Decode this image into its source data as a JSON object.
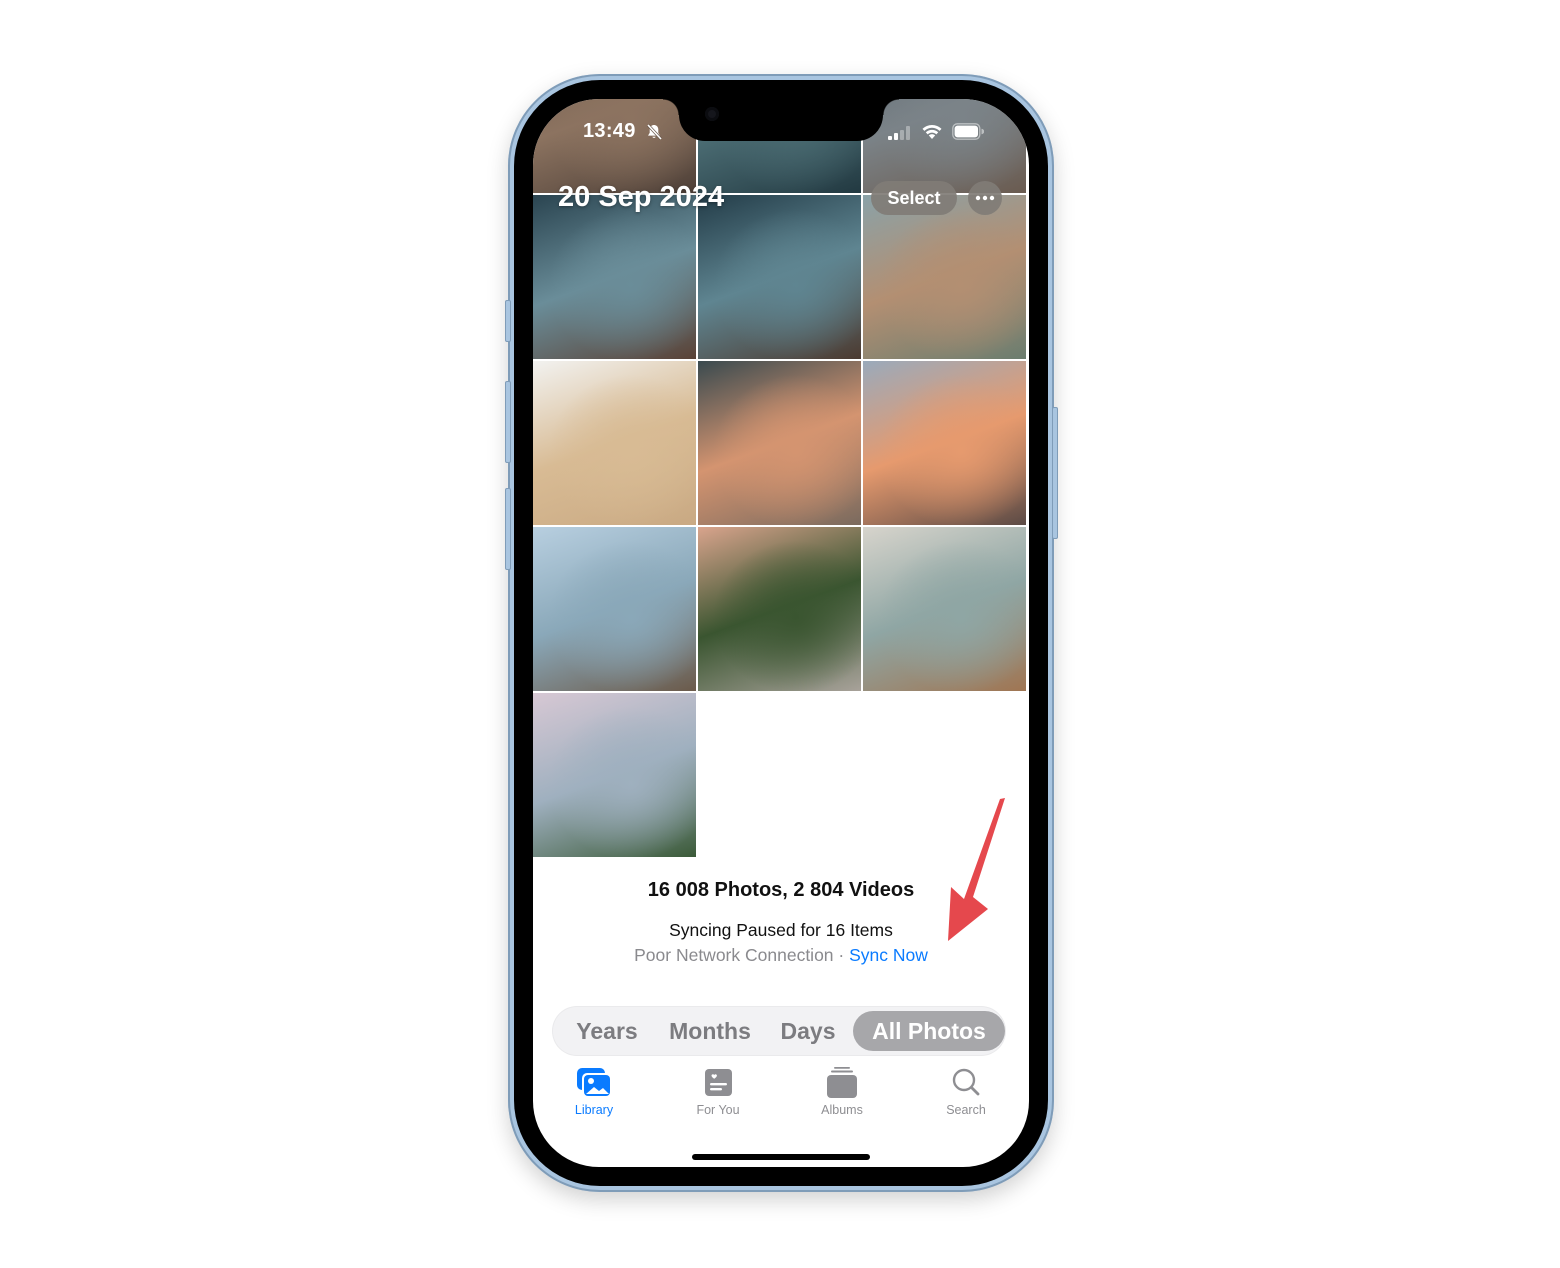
{
  "status_bar": {
    "time": "13:49",
    "silent_mode": true,
    "cellular_bars": 2,
    "wifi": true,
    "battery_level": 1.0
  },
  "header": {
    "date_title": "20 Sep 2024",
    "select_label": "Select",
    "more_icon": "ellipsis-icon"
  },
  "photos": [
    {
      "name": "beach-shore-dusk",
      "colors": [
        "#6e5a4e",
        "#8c7360",
        "#4d3f37"
      ]
    },
    {
      "name": "water-caustics",
      "colors": [
        "#2f4a55",
        "#4b6c73",
        "#223941"
      ]
    },
    {
      "name": "waves-on-sand",
      "colors": [
        "#5a6670",
        "#7b8388",
        "#6a5b50"
      ]
    },
    {
      "name": "rocky-coast-waves-1",
      "colors": [
        "#2a4450",
        "#6a8d99",
        "#5a4236"
      ]
    },
    {
      "name": "rocky-coast-waves-2",
      "colors": [
        "#233c48",
        "#5f8591",
        "#4c3a30"
      ]
    },
    {
      "name": "rose-wine-by-sea",
      "colors": [
        "#8aa2a8",
        "#b38f72",
        "#6b7d6f"
      ]
    },
    {
      "name": "starfish-on-sand",
      "colors": [
        "#f2f2f0",
        "#d8bb94",
        "#c9a983"
      ]
    },
    {
      "name": "sunset-beach-waves",
      "colors": [
        "#3a4a4f",
        "#d49470",
        "#7a6a5e"
      ]
    },
    {
      "name": "ocean-sunset",
      "colors": [
        "#9aaabb",
        "#e69a6e",
        "#5b4a45"
      ]
    },
    {
      "name": "cliff-coastline",
      "colors": [
        "#b8cfe0",
        "#8aa8b9",
        "#6b5a4a"
      ]
    },
    {
      "name": "palm-beach-pink-sky",
      "colors": [
        "#d9a48d",
        "#3a5530",
        "#a8a29a"
      ]
    },
    {
      "name": "hand-in-waves",
      "colors": [
        "#d7d4cc",
        "#8fa6a4",
        "#a07552"
      ]
    },
    {
      "name": "capri-faraglioni",
      "colors": [
        "#d7c8d4",
        "#9fb0bf",
        "#3b5a38"
      ]
    }
  ],
  "library_summary": {
    "count_text": "16 008 Photos, 2 804 Videos",
    "sync_status": "Syncing Paused for 16 Items",
    "sync_reason": "Poor Network Connection · ",
    "sync_action": "Sync Now"
  },
  "view_switcher": {
    "options": [
      "Years",
      "Months",
      "Days",
      "All Photos"
    ],
    "selected": "All Photos"
  },
  "tab_bar": {
    "items": [
      {
        "label": "Library",
        "icon": "photo-library-icon",
        "active": true
      },
      {
        "label": "For You",
        "icon": "for-you-icon",
        "active": false
      },
      {
        "label": "Albums",
        "icon": "albums-icon",
        "active": false
      },
      {
        "label": "Search",
        "icon": "search-icon",
        "active": false
      }
    ]
  },
  "colors": {
    "accent": "#0A7BFF",
    "annotation_arrow": "#E5484D",
    "phone_frame": "#A9C5E0",
    "segment_active": "#A7A7AA",
    "muted_text": "#8A8A8E"
  }
}
